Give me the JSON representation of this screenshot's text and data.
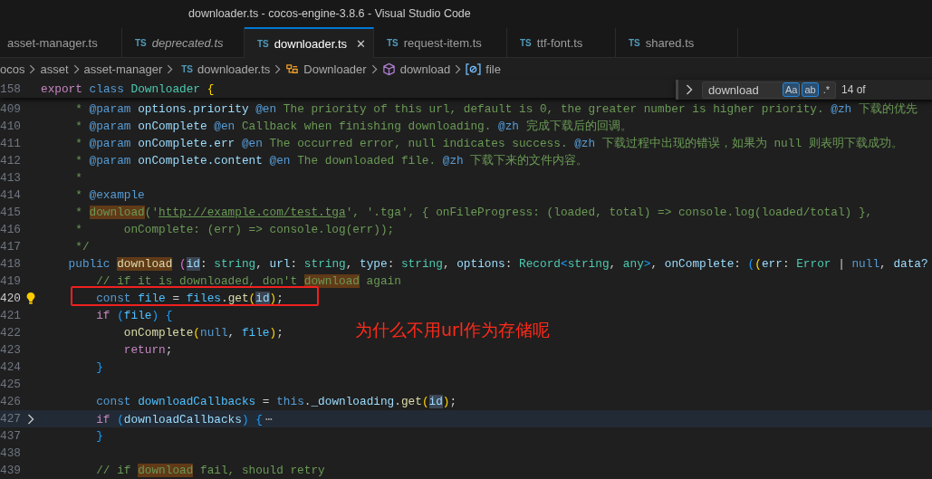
{
  "window": {
    "title": "downloader.ts - cocos-engine-3.8.6 - Visual Studio Code"
  },
  "tabs": [
    {
      "label": "asset-manager.ts",
      "selected": false,
      "preview": false
    },
    {
      "badge": "TS",
      "label": "deprecated.ts",
      "selected": false,
      "preview": true
    },
    {
      "badge": "TS",
      "label": "downloader.ts",
      "selected": true,
      "preview": false,
      "close": "✕"
    },
    {
      "badge": "TS",
      "label": "request-item.ts",
      "selected": false,
      "preview": false
    },
    {
      "badge": "TS",
      "label": "ttf-font.ts",
      "selected": false,
      "preview": false
    },
    {
      "badge": "TS",
      "label": "shared.ts",
      "selected": false,
      "preview": false
    }
  ],
  "breadcrumbs": [
    {
      "kind": "folder",
      "label": "ocos"
    },
    {
      "kind": "folder",
      "label": "asset"
    },
    {
      "kind": "folder",
      "label": "asset-manager"
    },
    {
      "kind": "file",
      "badge": "TS",
      "label": "downloader.ts"
    },
    {
      "kind": "class",
      "label": "Downloader"
    },
    {
      "kind": "method",
      "label": "download"
    },
    {
      "kind": "field",
      "label": "file"
    }
  ],
  "find": {
    "value": "download",
    "options": [
      {
        "label": "Aa",
        "on": true
      },
      {
        "label": "ab",
        "on": true
      },
      {
        "label": ".*",
        "on": false
      }
    ],
    "count": "14 of"
  },
  "sticky_line": {
    "number": "158",
    "tokens": [
      {
        "text": "export",
        "kind": "control"
      },
      {
        "text": " class",
        "kind": "storage"
      },
      {
        "text": " Downloader",
        "kind": "type"
      },
      {
        "text": " {",
        "kind": "bracket1"
      }
    ]
  },
  "lines": [
    {
      "number": "409",
      "tokens": [
        {
          "text": "     * ",
          "kind": "comment"
        },
        {
          "text": "@param",
          "kind": "tag"
        },
        {
          "text": " options.priority ",
          "kind": "param"
        },
        {
          "text": "@en",
          "kind": "tag"
        },
        {
          "text": " The priority of this url, default is 0, the greater number is higher priority. ",
          "kind": "comment"
        },
        {
          "text": "@zh",
          "kind": "tag"
        },
        {
          "text": " 下载的优先",
          "kind": "comment"
        }
      ]
    },
    {
      "number": "410",
      "tokens": [
        {
          "text": "     * ",
          "kind": "comment"
        },
        {
          "text": "@param",
          "kind": "tag"
        },
        {
          "text": " onComplete ",
          "kind": "param"
        },
        {
          "text": "@en",
          "kind": "tag"
        },
        {
          "text": " Callback when finishing downloading. ",
          "kind": "comment"
        },
        {
          "text": "@zh",
          "kind": "tag"
        },
        {
          "text": " 完成下载后的回调。",
          "kind": "comment"
        }
      ]
    },
    {
      "number": "411",
      "tokens": [
        {
          "text": "     * ",
          "kind": "comment"
        },
        {
          "text": "@param",
          "kind": "tag"
        },
        {
          "text": " onComplete.err ",
          "kind": "param"
        },
        {
          "text": "@en",
          "kind": "tag"
        },
        {
          "text": " The occurred error, null indicates success. ",
          "kind": "comment"
        },
        {
          "text": "@zh",
          "kind": "tag"
        },
        {
          "text": " 下载过程中出现的错误，如果为 null 则表明下载成功。",
          "kind": "comment"
        }
      ]
    },
    {
      "number": "412",
      "tokens": [
        {
          "text": "     * ",
          "kind": "comment"
        },
        {
          "text": "@param",
          "kind": "tag"
        },
        {
          "text": " onComplete.content ",
          "kind": "param"
        },
        {
          "text": "@en",
          "kind": "tag"
        },
        {
          "text": " The downloaded file. ",
          "kind": "comment"
        },
        {
          "text": "@zh",
          "kind": "tag"
        },
        {
          "text": " 下载下来的文件内容。",
          "kind": "comment"
        }
      ]
    },
    {
      "number": "413",
      "tokens": [
        {
          "text": "     *",
          "kind": "comment"
        }
      ]
    },
    {
      "number": "414",
      "tokens": [
        {
          "text": "     * ",
          "kind": "comment"
        },
        {
          "text": "@example",
          "kind": "tag"
        }
      ]
    },
    {
      "number": "415",
      "tokens": [
        {
          "text": "     * ",
          "kind": "comment"
        },
        {
          "text": "download",
          "kind": "match-comment"
        },
        {
          "text": "('",
          "kind": "comment"
        },
        {
          "text": "http://example.com/test.tga",
          "kind": "link"
        },
        {
          "text": "', '.tga', { onFileProgress: (loaded, total) => console.log(loaded/total) },",
          "kind": "comment"
        }
      ]
    },
    {
      "number": "416",
      "tokens": [
        {
          "text": "     *      onComplete: (err) => console.log(err));",
          "kind": "comment"
        }
      ]
    },
    {
      "number": "417",
      "tokens": [
        {
          "text": "     */",
          "kind": "comment"
        }
      ]
    },
    {
      "number": "418",
      "tokens": [
        {
          "text": "    public ",
          "kind": "storage"
        },
        {
          "text": "download",
          "kind": "match-function"
        },
        {
          "text": " (",
          "kind": "bracket2"
        },
        {
          "text": "id",
          "kind": "ref"
        },
        {
          "text": ":",
          "kind": "plain"
        },
        {
          "text": " string",
          "kind": "type"
        },
        {
          "text": ", ",
          "kind": "plain"
        },
        {
          "text": "url",
          "kind": "param"
        },
        {
          "text": ":",
          "kind": "plain"
        },
        {
          "text": " string",
          "kind": "type"
        },
        {
          "text": ", ",
          "kind": "plain"
        },
        {
          "text": "type",
          "kind": "param"
        },
        {
          "text": ":",
          "kind": "plain"
        },
        {
          "text": " string",
          "kind": "type"
        },
        {
          "text": ", ",
          "kind": "plain"
        },
        {
          "text": "options",
          "kind": "param"
        },
        {
          "text": ":",
          "kind": "plain"
        },
        {
          "text": " Record",
          "kind": "type"
        },
        {
          "text": "<",
          "kind": "bracket3"
        },
        {
          "text": "string",
          "kind": "type"
        },
        {
          "text": ", ",
          "kind": "plain"
        },
        {
          "text": "any",
          "kind": "type"
        },
        {
          "text": ">",
          "kind": "bracket3"
        },
        {
          "text": ", ",
          "kind": "plain"
        },
        {
          "text": "onComplete",
          "kind": "param"
        },
        {
          "text": ":",
          "kind": "plain"
        },
        {
          "text": " (",
          "kind": "bracket3"
        },
        {
          "text": "(",
          "kind": "bracket1"
        },
        {
          "text": "err",
          "kind": "param"
        },
        {
          "text": ":",
          "kind": "plain"
        },
        {
          "text": " Error",
          "kind": "type"
        },
        {
          "text": " | ",
          "kind": "plain"
        },
        {
          "text": "null",
          "kind": "storage"
        },
        {
          "text": ", ",
          "kind": "plain"
        },
        {
          "text": "data?",
          "kind": "param"
        }
      ]
    },
    {
      "number": "419",
      "tokens": [
        {
          "text": "        // if it is downloaded, don't ",
          "kind": "comment"
        },
        {
          "text": "download",
          "kind": "match-comment"
        },
        {
          "text": " again",
          "kind": "comment"
        }
      ]
    },
    {
      "number": "420",
      "cursor": true,
      "lightbulb": true,
      "tokens": [
        {
          "text": "        const ",
          "kind": "storage"
        },
        {
          "text": "file",
          "kind": "variable"
        },
        {
          "text": " = ",
          "kind": "plain"
        },
        {
          "text": "files",
          "kind": "variable"
        },
        {
          "text": ".",
          "kind": "plain"
        },
        {
          "text": "get",
          "kind": "function"
        },
        {
          "text": "(",
          "kind": "bracket1"
        },
        {
          "text": "id",
          "kind": "ref"
        },
        {
          "text": ")",
          "kind": "bracket1"
        },
        {
          "text": ";",
          "kind": "plain"
        }
      ]
    },
    {
      "number": "421",
      "tokens": [
        {
          "text": "        if ",
          "kind": "control"
        },
        {
          "text": "(",
          "kind": "bracket3"
        },
        {
          "text": "file",
          "kind": "variable"
        },
        {
          "text": ")",
          "kind": "bracket3"
        },
        {
          "text": " {",
          "kind": "bracket3"
        }
      ]
    },
    {
      "number": "422",
      "tokens": [
        {
          "text": "            onComplete",
          "kind": "function"
        },
        {
          "text": "(",
          "kind": "bracket1"
        },
        {
          "text": "null",
          "kind": "storage"
        },
        {
          "text": ", ",
          "kind": "plain"
        },
        {
          "text": "file",
          "kind": "variable"
        },
        {
          "text": ")",
          "kind": "bracket1"
        },
        {
          "text": ";",
          "kind": "plain"
        }
      ]
    },
    {
      "number": "423",
      "tokens": [
        {
          "text": "            return",
          "kind": "control"
        },
        {
          "text": ";",
          "kind": "plain"
        }
      ]
    },
    {
      "number": "424",
      "tokens": [
        {
          "text": "        }",
          "kind": "bracket3"
        }
      ]
    },
    {
      "number": "425"
    },
    {
      "number": "426",
      "tokens": [
        {
          "text": "        const ",
          "kind": "storage"
        },
        {
          "text": "downloadCallbacks",
          "kind": "variable"
        },
        {
          "text": " = ",
          "kind": "plain"
        },
        {
          "text": "this",
          "kind": "storage"
        },
        {
          "text": ".",
          "kind": "plain"
        },
        {
          "text": "_downloading",
          "kind": "param"
        },
        {
          "text": ".",
          "kind": "plain"
        },
        {
          "text": "get",
          "kind": "function"
        },
        {
          "text": "(",
          "kind": "bracket1"
        },
        {
          "text": "id",
          "kind": "ref"
        },
        {
          "text": ")",
          "kind": "bracket1"
        },
        {
          "text": ";",
          "kind": "plain"
        }
      ]
    },
    {
      "number": "427",
      "folded": true,
      "tokens": [
        {
          "text": "        if",
          "kind": "control"
        },
        {
          "text": " (",
          "kind": "bracket3"
        },
        {
          "text": "downloadCallbacks",
          "kind": "param"
        },
        {
          "text": ")",
          "kind": "bracket3"
        },
        {
          "text": " {",
          "kind": "bracket3"
        },
        {
          "text": "⋯",
          "kind": "fold"
        }
      ]
    },
    {
      "number": "437",
      "tokens": [
        {
          "text": "        }",
          "kind": "bracket3"
        }
      ]
    },
    {
      "number": "438"
    },
    {
      "number": "439",
      "tokens": [
        {
          "text": "        // if ",
          "kind": "comment"
        },
        {
          "text": "download",
          "kind": "match-comment"
        },
        {
          "text": " fail, should retry",
          "kind": "comment"
        }
      ]
    }
  ],
  "annotation": {
    "text": "为什么不用url作为存储呢"
  }
}
